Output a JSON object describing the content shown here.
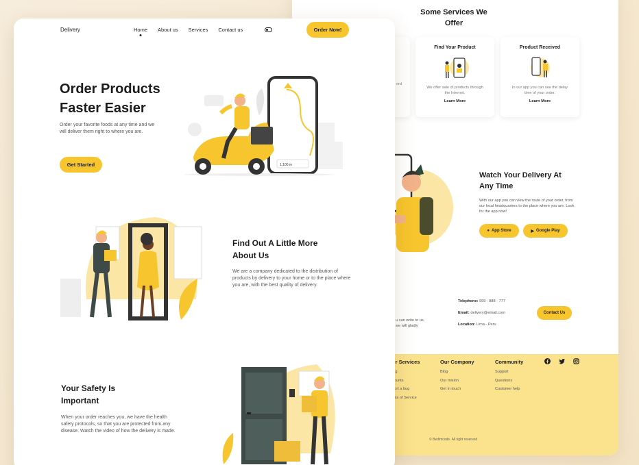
{
  "nav": {
    "logo": "Delivery",
    "links": [
      "Home",
      "About us",
      "Services",
      "Contact us"
    ],
    "order_button": "Order Now!"
  },
  "hero": {
    "title": "Order Products Faster Easier",
    "text": "Order your favorite foods at any time and we will deliver them right to where you are.",
    "cta": "Get Started",
    "map_distance": "1,100 m"
  },
  "about": {
    "title": "Find Out A Little More About Us",
    "text": "We are a company dedicated to the distribution of products by delivery to your home or to the place where you are, with the best quality of delivery."
  },
  "safety": {
    "title": "Your Safety Is Important",
    "text": "When your order reaches you, we have the health safety protocols, so that you are protected from any disease. Watch the video of how the delivery is made."
  },
  "services": {
    "title": "Some Services We Offer",
    "partial_card_text": "ord",
    "cards": [
      {
        "title": "Find Your Product",
        "text": "We offer sale of products through the Internet.",
        "link": "Learn More"
      },
      {
        "title": "Product Received",
        "text": "In our app you can see the delay time of your order.",
        "link": "Learn More"
      }
    ]
  },
  "watch": {
    "title": "Watch Your Delivery At Any Time",
    "text": "With our app you can view the route of your order, from our local headquarters to the place where you are. Look for the app now!",
    "app_store": "App Store",
    "google_play": "Google Play"
  },
  "contact": {
    "left_text": "u can write to us, we will gladly",
    "telephone_label": "Telephone:",
    "telephone": "999 - 888 - 777",
    "email_label": "Email:",
    "email": "delivery@email.com",
    "location_label": "Location:",
    "location": "Lima - Peru",
    "button": "Contact Us"
  },
  "footer": {
    "col1": {
      "title": "ur Services",
      "items": [
        "ing",
        "counts",
        "port a bug",
        "rms of Service"
      ]
    },
    "col2": {
      "title": "Our Company",
      "items": [
        "Blog",
        "Our mision",
        "Get in touch"
      ]
    },
    "col3": {
      "title": "Community",
      "items": [
        "Support",
        "Questions",
        "Customer help"
      ]
    },
    "social_icons": [
      "facebook-icon",
      "twitter-icon",
      "instagram-icon"
    ],
    "copyright": "© Bedimcode. All right reserved"
  },
  "colors": {
    "accent": "#f7c52e",
    "footer_bg": "#fbe28c",
    "dark": "#222222"
  }
}
